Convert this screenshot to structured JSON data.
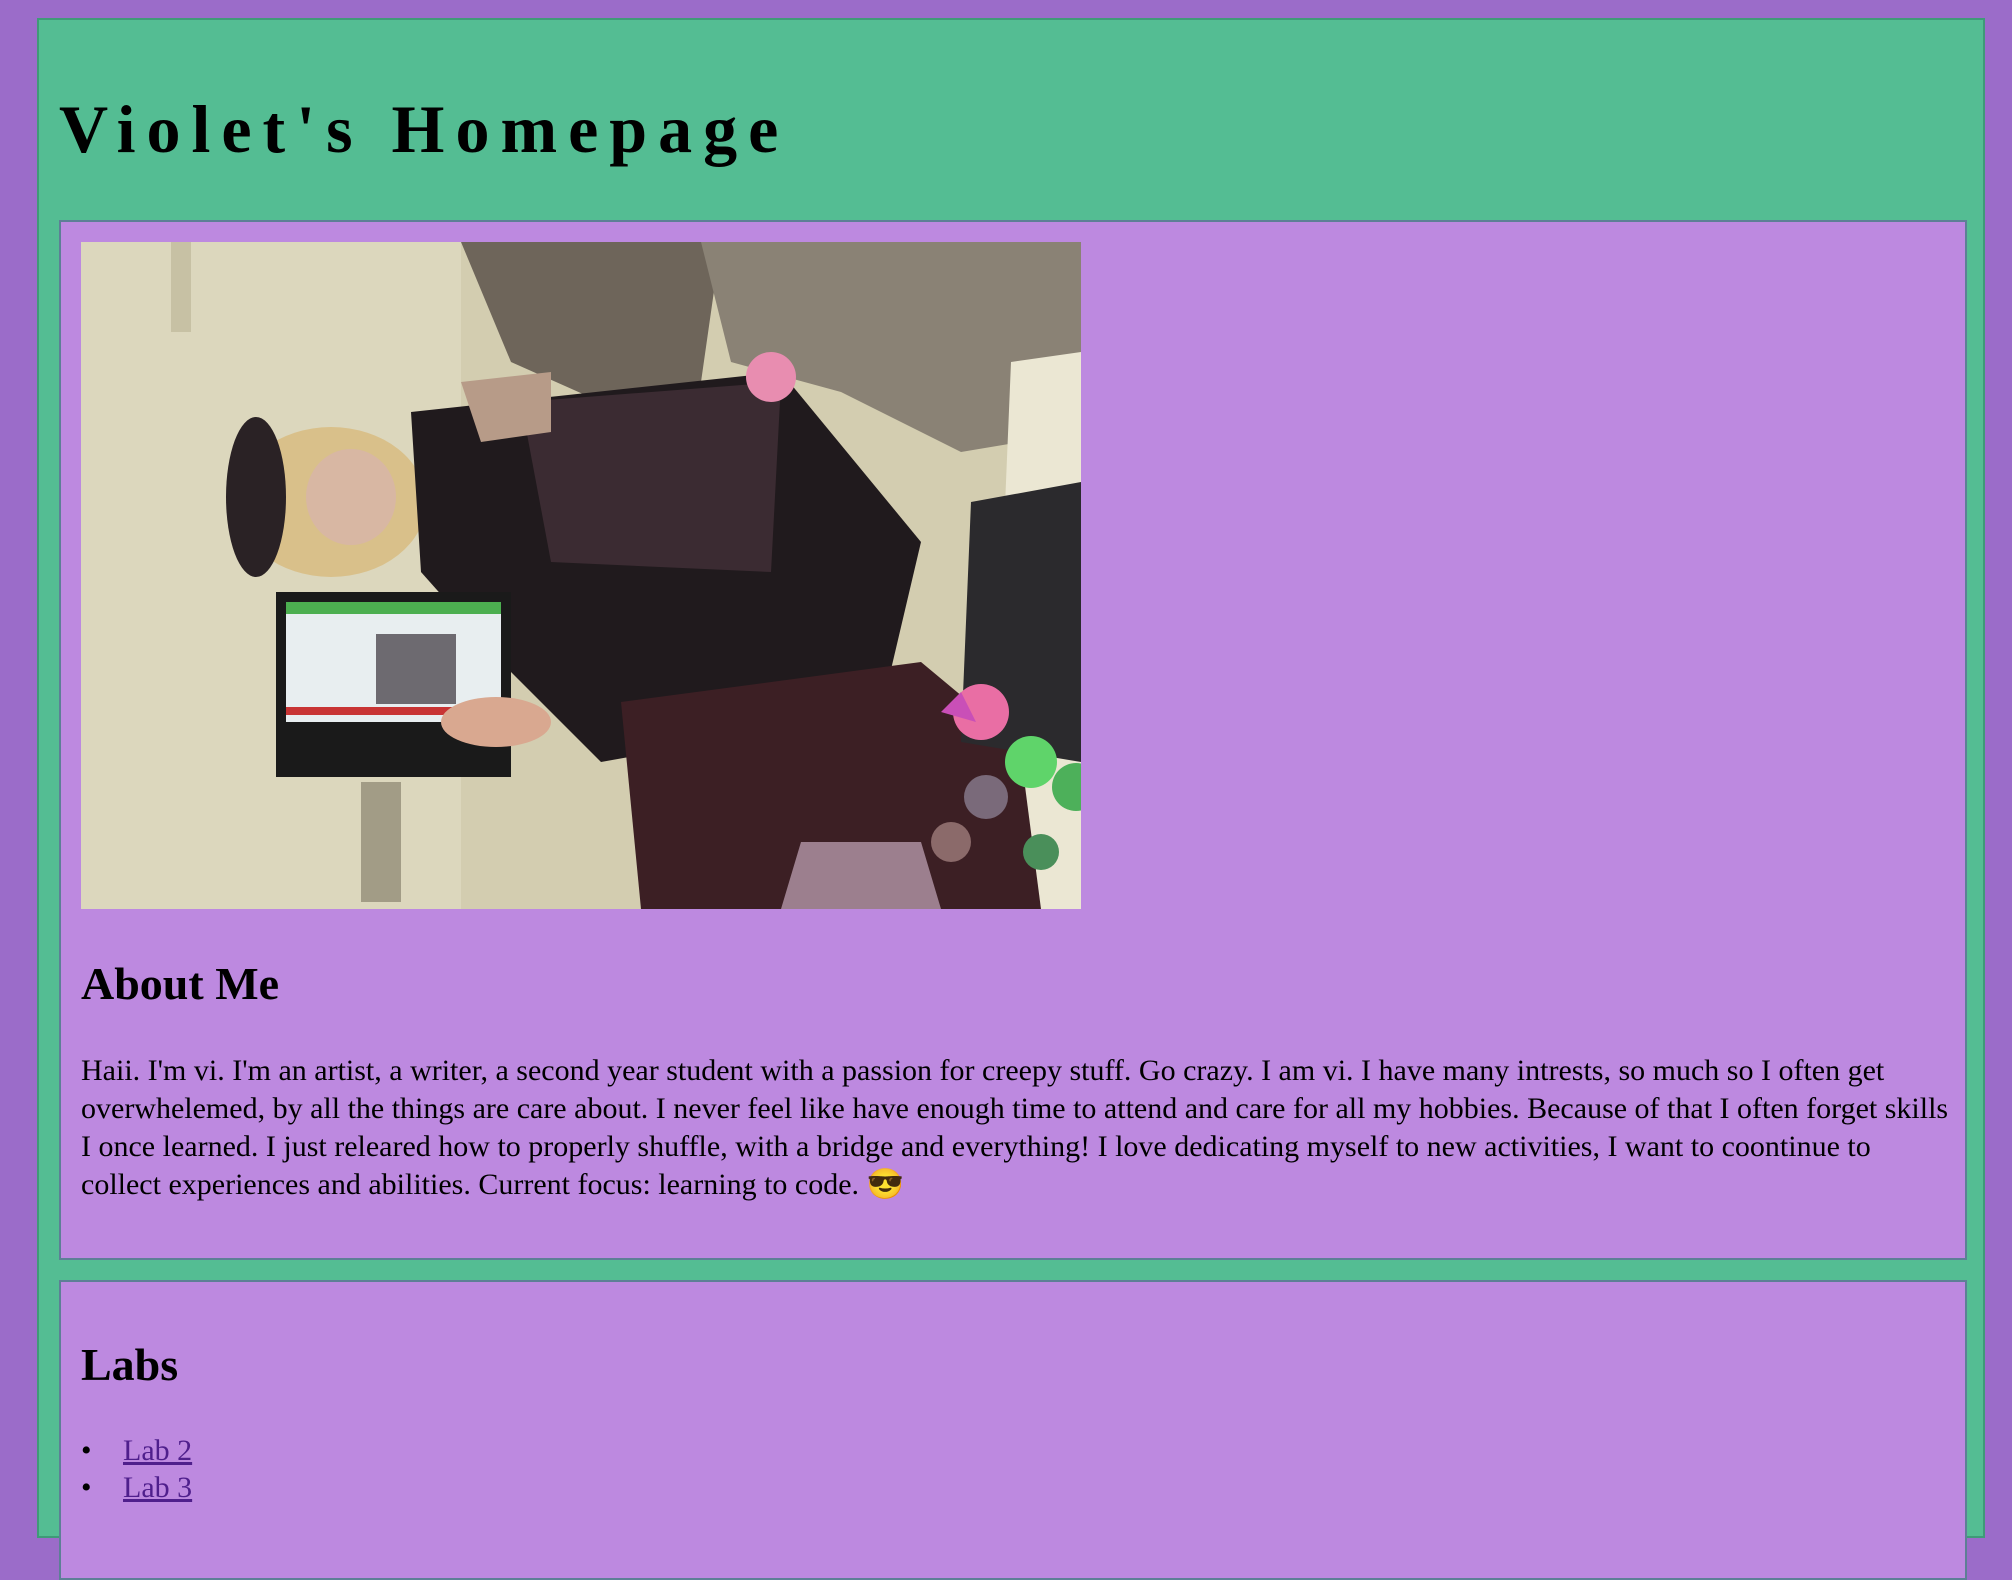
{
  "site": {
    "title": "Violet's Homepage"
  },
  "about": {
    "heading": "About Me",
    "text": "Haii. I'm vi. I'm an artist, a writer, a second year student with a passion for creepy stuff. Go crazy. I am vi. I have many intrests, so much so I often get overwhelemed, by all the things are care about. I never feel like have enough time to attend and care for all my hobbies. Because of that I often forget skills I once learned. I just releared how to properly shuffle, with a bridge and everything! I love dedicating myself to new activities, I want to coontinue to collect experiences and abilities. Current focus: learning to code. 😎"
  },
  "labs": {
    "heading": "Labs",
    "items": [
      {
        "label": "Lab 2"
      },
      {
        "label": "Lab 3"
      }
    ]
  },
  "colors": {
    "outer_background": "#9b6cc9",
    "page_background": "#54bd93",
    "card_background": "#bd89e0",
    "link": "#4f1f8c"
  }
}
